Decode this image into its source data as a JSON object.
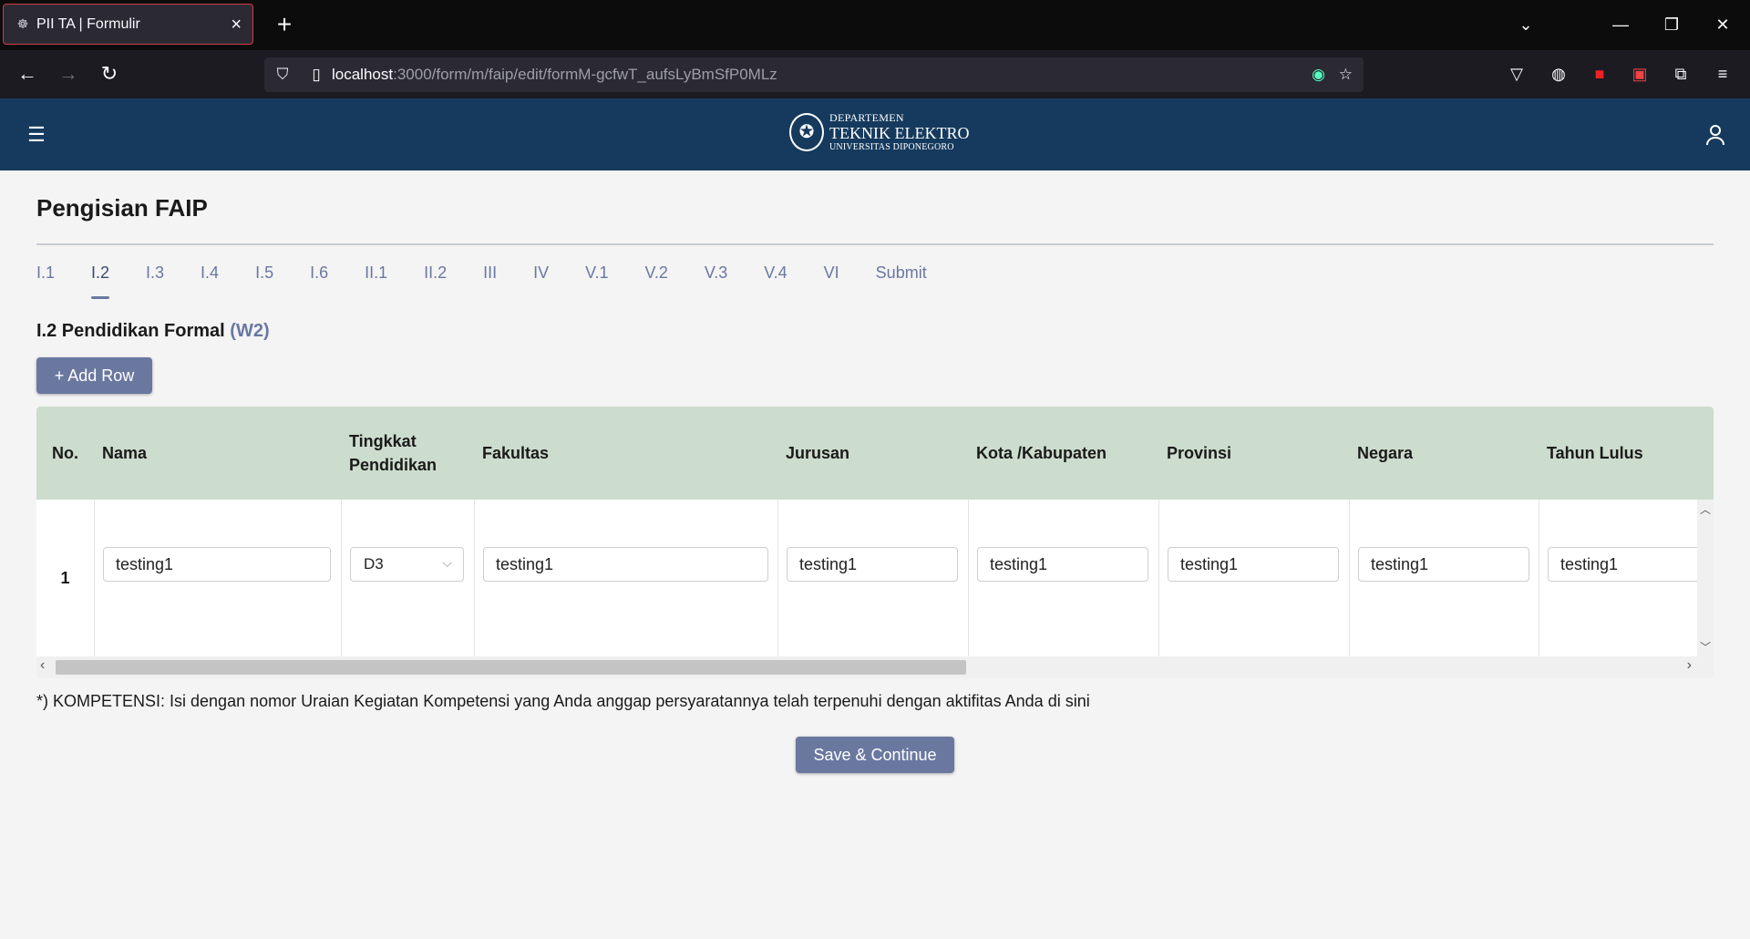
{
  "browser": {
    "tab_title": "PII TA | Formulir",
    "url_host": "localhost",
    "url_path": ":3000/form/m/faip/edit/formM-gcfwT_aufsLyBmSfP0MLz"
  },
  "header": {
    "logo_line1": "DEPARTEMEN",
    "logo_line2": "TEKNIK ELEKTRO",
    "logo_line3": "UNIVERSITAS DIPONEGORO"
  },
  "page": {
    "title": "Pengisian FAIP",
    "steps": [
      "I.1",
      "I.2",
      "I.3",
      "I.4",
      "I.5",
      "I.6",
      "II.1",
      "II.2",
      "III",
      "IV",
      "V.1",
      "V.2",
      "V.3",
      "V.4",
      "VI",
      "Submit"
    ],
    "active_step": "I.2",
    "section_title": "I.2 Pendidikan Formal",
    "section_badge": "(W2)",
    "add_row_label": "+ Add Row",
    "columns": [
      "No.",
      "Nama",
      "Tingkkat Pendidikan",
      "Fakultas",
      "Jurusan",
      "Kota /Kabupaten",
      "Provinsi",
      "Negara",
      "Tahun Lulus"
    ],
    "rows": [
      {
        "no": "1",
        "nama": "testing1",
        "tingkat": "D3",
        "fakultas": "testing1",
        "jurusan": "testing1",
        "kota": "testing1",
        "provinsi": "testing1",
        "negara": "testing1",
        "tahun": "testing1"
      }
    ],
    "note": "*) KOMPETENSI: Isi dengan nomor Uraian Kegiatan Kompetensi yang Anda anggap persyaratannya telah terpenuhi dengan aktifitas Anda di sini",
    "save_label": "Save & Continue"
  }
}
